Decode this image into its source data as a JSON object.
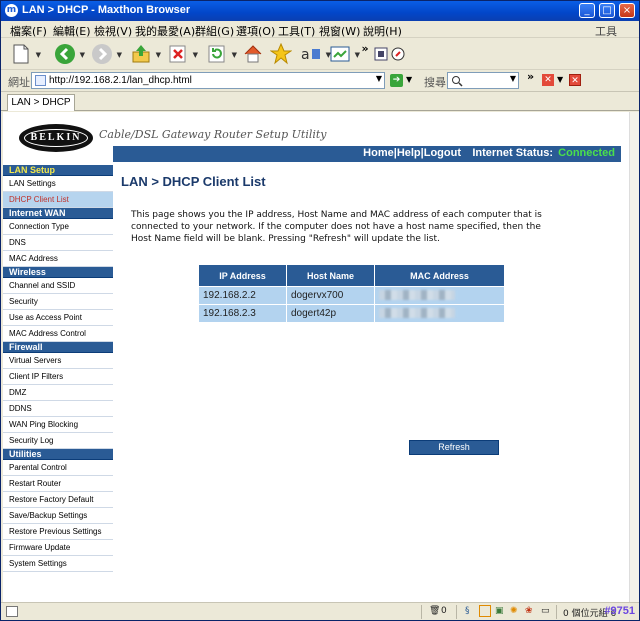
{
  "window": {
    "title": "LAN > DHCP - Maxthon Browser"
  },
  "menu": {
    "items": [
      "檔案(F)",
      "編輯(E)",
      "檢視(V)",
      "我的最愛(A)",
      "群組(G)",
      "選項(O)",
      "工具(T)",
      "視窗(W)",
      "說明(H)"
    ],
    "tools_label": "工具"
  },
  "address": {
    "label": "網址",
    "url": "http://192.168.2.1/lan_dhcp.html",
    "search_label": "搜尋"
  },
  "tab": {
    "label": "LAN > DHCP"
  },
  "banner": {
    "logo": "BELKIN",
    "tagline": "Cable/DSL Gateway Router Setup Utility"
  },
  "topnav": {
    "home": "Home",
    "help": "Help",
    "logout": "Logout",
    "status_label": "Internet Status:",
    "status_value": "Connected",
    "status_color": "#4be04b"
  },
  "sidebar": {
    "sections": [
      {
        "title": "LAN Setup",
        "items": [
          "LAN Settings",
          "DHCP Client List"
        ]
      },
      {
        "title": "Internet WAN",
        "items": [
          "Connection Type",
          "DNS",
          "MAC Address"
        ]
      },
      {
        "title": "Wireless",
        "items": [
          "Channel and SSID",
          "Security",
          "Use as Access Point",
          "MAC Address Control"
        ]
      },
      {
        "title": "Firewall",
        "items": [
          "Virtual Servers",
          "Client IP Filters",
          "DMZ",
          "DDNS",
          "WAN Ping Blocking",
          "Security Log"
        ]
      },
      {
        "title": "Utilities",
        "items": [
          "Parental Control",
          "Restart Router",
          "Restore Factory Default",
          "Save/Backup Settings",
          "Restore Previous Settings",
          "Firmware Update",
          "System Settings"
        ]
      }
    ],
    "active": "DHCP Client List"
  },
  "main": {
    "title": "LAN > DHCP Client List",
    "description": "This page shows you the IP address, Host Name and MAC address of each computer that is connected to your network. If the computer does not have a host name specified, then the Host Name field will be blank. Pressing \"Refresh\" will update the list.",
    "columns": [
      "IP Address",
      "Host Name",
      "MAC Address"
    ],
    "rows": [
      {
        "ip": "192.168.2.2",
        "host": "dogervx700"
      },
      {
        "ip": "192.168.2.3",
        "host": "dogert42p"
      }
    ],
    "refresh_label": "Refresh"
  },
  "statusbar": {
    "count": "0",
    "right_text": "0 個位元組 6",
    "watermark": "#9751"
  },
  "colors": {
    "nav_blue": "#2a5b95",
    "row_blue": "#b3d3ef",
    "active_red": "#c0312a"
  }
}
